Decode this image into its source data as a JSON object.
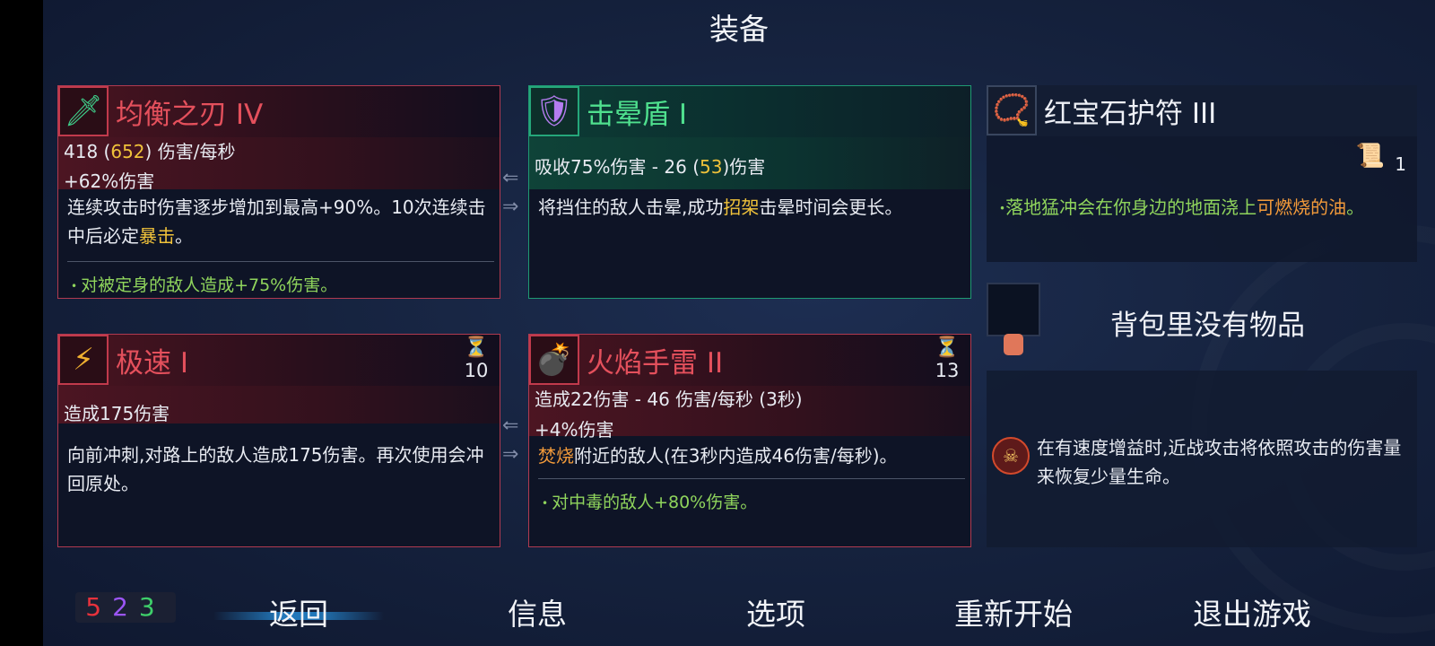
{
  "title": "装备",
  "cards": {
    "balanced_blade": {
      "name": "均衡之刃 IV",
      "dps_base": "418",
      "dps_boost": "652",
      "dps_unit": "伤害/每秒",
      "damage_bonus": "+62%伤害",
      "desc_part1": "连续攻击时伤害逐步增加到最高+90%。10次连续击中后必定",
      "desc_keyword": "暴击",
      "desc_part2": "。",
      "bonus": "对被定身的敌人造成+75%伤害。",
      "icon": "blade-icon"
    },
    "stun_shield": {
      "name": "击晕盾 I",
      "stat_prefix": "吸收75%伤害 - 26 (",
      "stat_boost": "53",
      "stat_suffix": ")伤害",
      "desc_part1": "将挡住的敌人击晕,成功",
      "desc_keyword": "招架",
      "desc_part2": "击晕时间会更长。",
      "icon": "shield-icon"
    },
    "ruby_amulet": {
      "name": "红宝石护符 III",
      "scroll_count": "1",
      "bonus_part1": "落地猛冲会在你身边的地面浇上",
      "bonus_keyword": "可燃烧的油",
      "bonus_part2": "。",
      "icon": "amulet-icon"
    },
    "speed": {
      "name": "极速 I",
      "cooldown": "10",
      "stat": "造成175伤害",
      "desc": "向前冲刺,对路上的敌人造成175伤害。再次使用会冲回原处。",
      "icon": "speed-icon"
    },
    "fire_grenade": {
      "name": "火焰手雷 II",
      "cooldown": "13",
      "stat1": "造成22伤害 - 46 伤害/每秒 (3秒)",
      "stat2": "+4%伤害",
      "desc_keyword": "焚烧",
      "desc_rest": "附近的敌人(在3秒内造成46伤害/每秒)。",
      "bonus": "对中毒的敌人+80%伤害。",
      "icon": "grenade-icon"
    }
  },
  "backpack": {
    "empty_text": "背包里没有物品"
  },
  "mutation": {
    "desc": "在有速度增益时,近战攻击将依照攻击的伤害量来恢复少量生命。"
  },
  "status_counts": {
    "red": "5",
    "purple": "2",
    "green": "3"
  },
  "menu": {
    "back": "返回",
    "info": "信息",
    "options": "选项",
    "restart": "重新开始",
    "quit": "退出游戏"
  },
  "colors": {
    "red_item": "#e4505c",
    "green_item": "#4fe08e",
    "keyword_gold": "#f0c23a",
    "keyword_orange": "#f29a3a",
    "bonus_green": "#8fd45c",
    "count_red": "#e8323c",
    "count_purple": "#9b55f5",
    "count_green": "#3ecf6a"
  }
}
